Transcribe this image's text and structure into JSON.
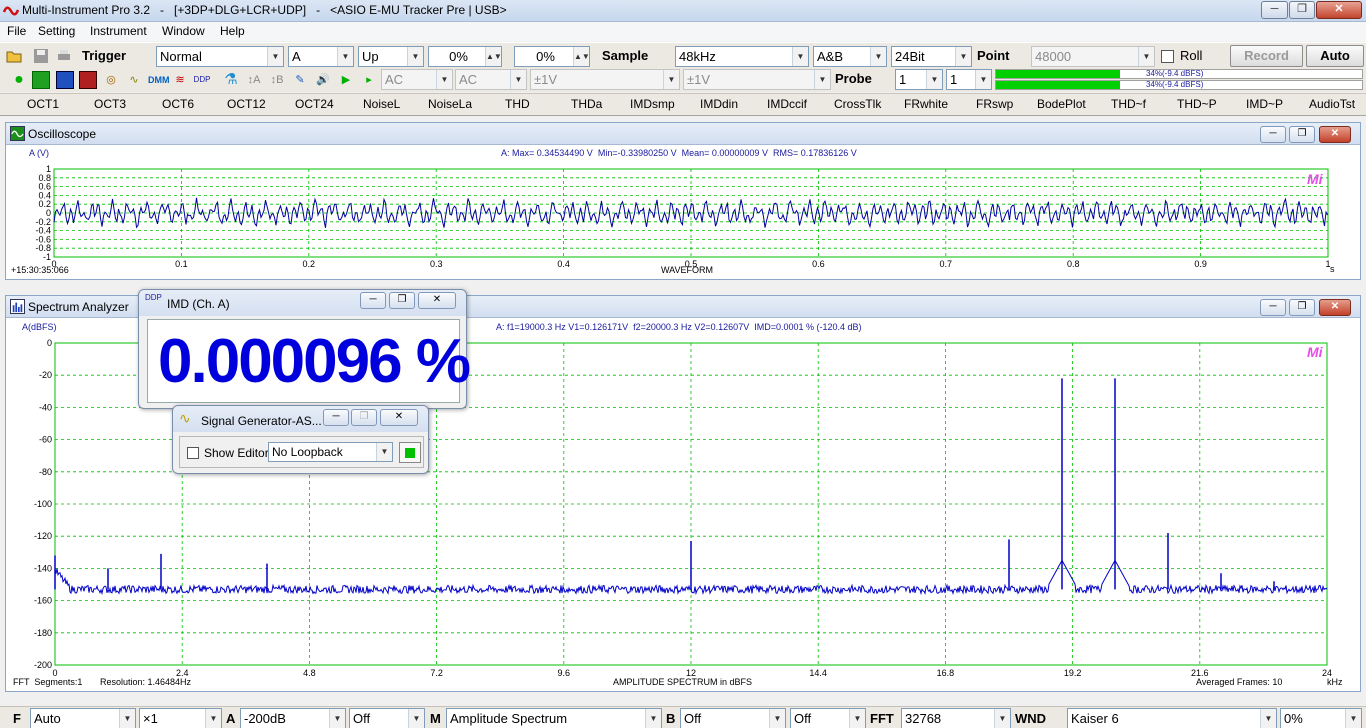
{
  "window": {
    "title": "Multi-Instrument Pro 3.2   -   [+3DP+DLG+LCR+UDP]   -   <ASIO E-MU Tracker Pre | USB>",
    "minimize": "─",
    "restore": "❐",
    "close": "✕"
  },
  "menu": [
    "File",
    "Setting",
    "Instrument",
    "Window",
    "Help"
  ],
  "toolbar1": {
    "trigger_label": "Trigger",
    "trigger_mode": "Normal",
    "trigger_channel": "A",
    "trigger_edge": "Up",
    "trigger_level": "0%",
    "trigger_delay": "0%",
    "sample_label": "Sample",
    "sample_rate": "48kHz",
    "channels": "A&B",
    "bit_depth": "24Bit",
    "point_label": "Point",
    "point_value": "48000",
    "roll_label": "Roll",
    "record_label": "Record",
    "auto_label": "Auto"
  },
  "toolbar2": {
    "coupling_a": "AC",
    "coupling_b": "AC",
    "range_a": "±1V",
    "range_b": "±1V",
    "probe_label": "Probe",
    "probe_a": "1",
    "probe_b": "1",
    "level_a_text": "34%(-9.4 dBFS)",
    "level_b_text": "34%(-9.4 dBFS)",
    "level_a_fraction": 0.34,
    "level_b_fraction": 0.34,
    "level_color": "#00d000"
  },
  "presets": [
    "OCT1",
    "OCT3",
    "OCT6",
    "OCT12",
    "OCT24",
    "NoiseL",
    "NoiseLa",
    "THD",
    "THDa",
    "IMDsmp",
    "IMDdin",
    "IMDccif",
    "CrossTlk",
    "FRwhite",
    "FRswp",
    "BodePlot",
    "THD~f",
    "THD~P",
    "IMD~P",
    "AudioTst"
  ],
  "oscilloscope": {
    "title": "Oscilloscope",
    "ylabel": "A (V)",
    "info": "A: Max= 0.34534490 V  Min=-0.33980250 V  Mean= 0.00000009 V  RMS= 0.17836126 V",
    "y_ticks": [
      "1",
      "0.8",
      "0.6",
      "0.4",
      "0.2",
      "0",
      "-0.2",
      "-0.4",
      "-0.6",
      "-0.8",
      "-1"
    ],
    "x_ticks": [
      "0",
      "0.1",
      "0.2",
      "0.3",
      "0.4",
      "0.5",
      "0.6",
      "0.7",
      "0.8",
      "0.9",
      "1"
    ],
    "x_unit": "s",
    "xlabel": "WAVEFORM",
    "timestamp": "+15:30:35:066",
    "logo": "Mi",
    "trace_color": "#0000a0"
  },
  "spectrum": {
    "title": "Spectrum Analyzer",
    "ylabel": "A(dBFS)",
    "info": "A: f1=19000.3 Hz V1=0.126171V  f2=20000.3 Hz V2=0.12607V  IMD=0.0001 % (-120.4 dB)",
    "y_ticks": [
      "0",
      "-20",
      "-40",
      "-60",
      "-80",
      "-100",
      "-120",
      "-140",
      "-160",
      "-180",
      "-200"
    ],
    "x_ticks": [
      "0",
      "2.4",
      "4.8",
      "7.2",
      "9.6",
      "12",
      "14.4",
      "16.8",
      "19.2",
      "21.6",
      "24"
    ],
    "x_unit": "kHz",
    "xlabel": "AMPLITUDE SPECTRUM in dBFS",
    "fft_segments": "FFT  Segments:1",
    "resolution": "Resolution: 1.46484Hz",
    "averaged": "Averaged Frames: 10",
    "logo": "Mi",
    "trace_color": "#0000c8"
  },
  "chart_data": [
    {
      "type": "line",
      "ylabel": "A (V)",
      "xlabel": "WAVEFORM",
      "xlim": [
        0,
        1
      ],
      "ylim": [
        -1,
        1
      ],
      "series": [
        {
          "values_summary": {
            "max": 0.3453449,
            "min": -0.3398025,
            "mean": 9e-08,
            "rms": 0.17836126
          }
        }
      ]
    },
    {
      "type": "line",
      "ylabel": "A(dBFS)",
      "xlabel": "AMPLITUDE SPECTRUM in dBFS",
      "xlim": [
        0,
        24
      ],
      "ylim": [
        -200,
        0
      ],
      "noise_floor_db": -153,
      "peaks": [
        {
          "x": 0,
          "y": -132
        },
        {
          "x": 1.0,
          "y": -140
        },
        {
          "x": 2.0,
          "y": -131
        },
        {
          "x": 4.0,
          "y": -137
        },
        {
          "x": 12.0,
          "y": -123
        },
        {
          "x": 18.0,
          "y": -122
        },
        {
          "x": 19.0,
          "y": -22
        },
        {
          "x": 20.0,
          "y": -22
        },
        {
          "x": 21.0,
          "y": -118
        },
        {
          "x": 22.0,
          "y": -143
        },
        {
          "x": 23.0,
          "y": -148
        }
      ]
    }
  ],
  "imd_window": {
    "title": "IMD (Ch. A)",
    "value": "0.000096 %",
    "value_color": "#0000dd"
  },
  "siggen_window": {
    "title": "Signal Generator-AS...",
    "show_editor_label": "Show Editor",
    "loopback": "No Loopback",
    "run_color": "#00c000"
  },
  "statusbar": {
    "f_label": "F",
    "f_value": "Auto",
    "zoom_value": "×1",
    "a_label": "A",
    "a_value": "-200dB",
    "a_mode": "Off",
    "m_label": "M",
    "m_value": "Amplitude Spectrum",
    "b_label": "B",
    "b_value": "Off",
    "b_mode": "Off",
    "fft_label": "FFT",
    "fft_value": "32768",
    "wnd_label": "WND",
    "wnd_value": "Kaiser 6",
    "overlap_value": "0%"
  }
}
